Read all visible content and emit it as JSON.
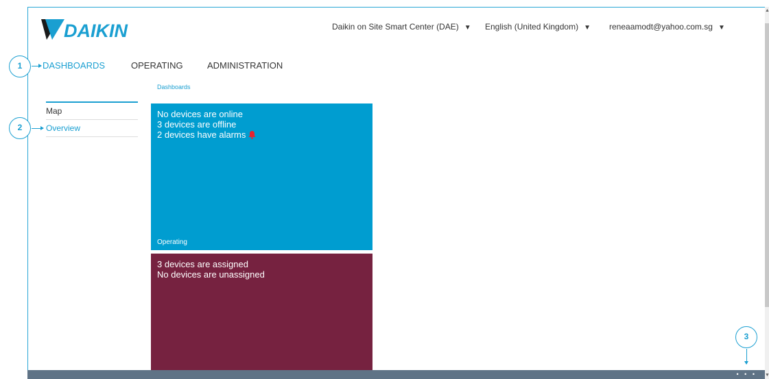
{
  "header": {
    "logo_text": "DAIKIN",
    "site_selector": "Daikin on Site Smart Center (DAE)",
    "language_selector": "English (United Kingdom)",
    "user_selector": "reneaamodt@yahoo.com.sg"
  },
  "main_nav": {
    "items": [
      {
        "label": "DASHBOARDS",
        "active": true
      },
      {
        "label": "OPERATING",
        "active": false
      },
      {
        "label": "ADMINISTRATION",
        "active": false
      }
    ]
  },
  "breadcrumb": "Dashboards",
  "side_nav": {
    "items": [
      {
        "label": "Map",
        "active": false
      },
      {
        "label": "Overview",
        "active": true
      }
    ]
  },
  "tiles": {
    "operating": {
      "lines": [
        "No devices are online",
        "3 devices are offline",
        "2 devices have alarms"
      ],
      "footer": "Operating",
      "color": "#009dd0",
      "alarm_icon": "bell-icon",
      "alarm_icon_color": "#e8232f"
    },
    "administration": {
      "lines": [
        "3 devices are assigned",
        "No devices are unassigned"
      ],
      "color": "#762240"
    }
  },
  "bottom_bar": {
    "menu_label": "• • •",
    "color": "#5f7386"
  },
  "callouts": [
    "1",
    "2",
    "3"
  ],
  "colors": {
    "accent": "#1a9fd1",
    "logo_blue": "#1a9fd1"
  }
}
